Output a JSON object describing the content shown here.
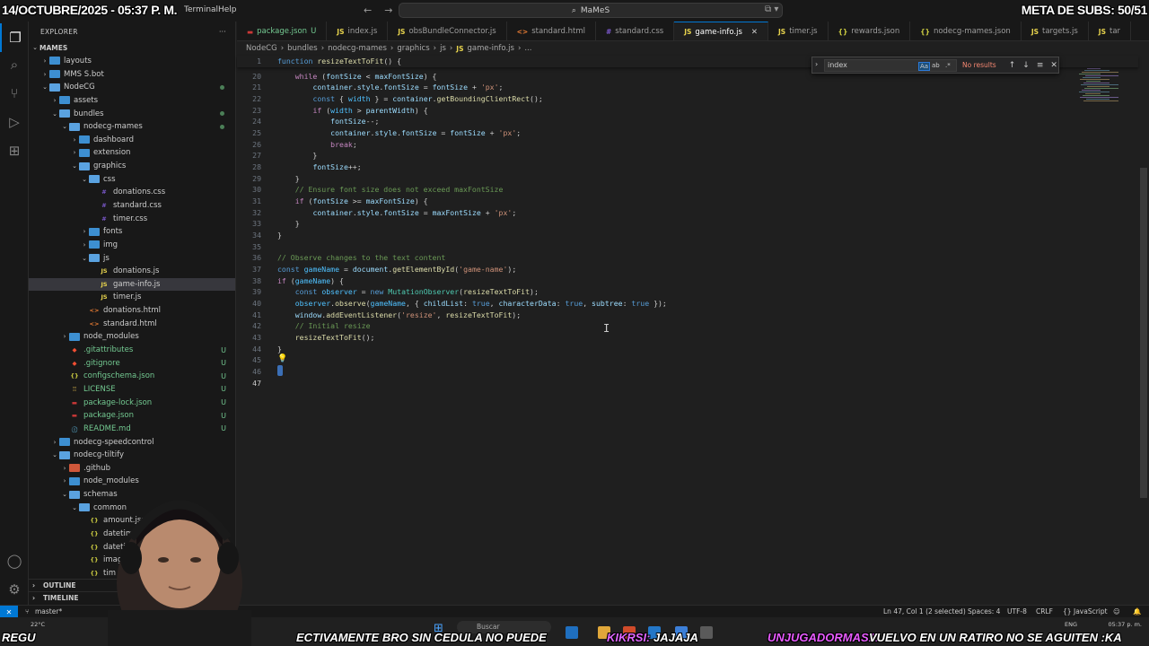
{
  "overlay": {
    "date": "14/OCTUBRE/2025 - 05:37 P. M.",
    "subs": "META DE SUBS: 50/51"
  },
  "titlebar": {
    "menus": [
      "Terminal",
      "Help"
    ],
    "command_center": "MaMeS"
  },
  "sidebar": {
    "title": "EXPLORER",
    "root": "MAMES",
    "tree": [
      {
        "label": "layouts",
        "kind": "folder",
        "indent": 1,
        "open": false
      },
      {
        "label": "MMS S.bot",
        "kind": "folder",
        "indent": 1,
        "open": false
      },
      {
        "label": "NodeCG",
        "kind": "folder",
        "indent": 1,
        "open": true,
        "mod": true
      },
      {
        "label": "assets",
        "kind": "folder",
        "indent": 2,
        "open": false
      },
      {
        "label": "bundles",
        "kind": "folder",
        "indent": 2,
        "open": true,
        "mod": true
      },
      {
        "label": "nodecg-mames",
        "kind": "folder",
        "indent": 3,
        "open": true,
        "mod": true
      },
      {
        "label": "dashboard",
        "kind": "folder",
        "indent": 4,
        "open": false
      },
      {
        "label": "extension",
        "kind": "folder",
        "indent": 4,
        "open": false
      },
      {
        "label": "graphics",
        "kind": "folder",
        "indent": 4,
        "open": true
      },
      {
        "label": "css",
        "kind": "folder",
        "indent": 5,
        "open": true
      },
      {
        "label": "donations.css",
        "kind": "css",
        "indent": 6
      },
      {
        "label": "standard.css",
        "kind": "css",
        "indent": 6
      },
      {
        "label": "timer.css",
        "kind": "css",
        "indent": 6
      },
      {
        "label": "fonts",
        "kind": "folder",
        "indent": 5,
        "open": false
      },
      {
        "label": "img",
        "kind": "folder",
        "indent": 5,
        "open": false
      },
      {
        "label": "js",
        "kind": "folder",
        "indent": 5,
        "open": true
      },
      {
        "label": "donations.js",
        "kind": "js",
        "indent": 6
      },
      {
        "label": "game-info.js",
        "kind": "js",
        "indent": 6,
        "selected": true
      },
      {
        "label": "timer.js",
        "kind": "js",
        "indent": 6
      },
      {
        "label": "donations.html",
        "kind": "html",
        "indent": 5
      },
      {
        "label": "standard.html",
        "kind": "html",
        "indent": 5
      },
      {
        "label": "node_modules",
        "kind": "folder",
        "indent": 3,
        "open": false
      },
      {
        "label": ".gitattributes",
        "kind": "git",
        "indent": 3,
        "badge": "U"
      },
      {
        "label": ".gitignore",
        "kind": "git",
        "indent": 3,
        "badge": "U"
      },
      {
        "label": "configschema.json",
        "kind": "json",
        "indent": 3,
        "badge": "U"
      },
      {
        "label": "LICENSE",
        "kind": "license",
        "indent": 3,
        "badge": "U"
      },
      {
        "label": "package-lock.json",
        "kind": "npm",
        "indent": 3,
        "badge": "U"
      },
      {
        "label": "package.json",
        "kind": "npm",
        "indent": 3,
        "badge": "U"
      },
      {
        "label": "README.md",
        "kind": "md",
        "indent": 3,
        "badge": "U"
      },
      {
        "label": "nodecg-speedcontrol",
        "kind": "folder",
        "indent": 2,
        "open": false
      },
      {
        "label": "nodecg-tiltify",
        "kind": "folder",
        "indent": 2,
        "open": true
      },
      {
        "label": ".github",
        "kind": "gitfolder",
        "indent": 3,
        "open": false
      },
      {
        "label": "node_modules",
        "kind": "folder",
        "indent": 3,
        "open": false
      },
      {
        "label": "schemas",
        "kind": "folder",
        "indent": 3,
        "open": true
      },
      {
        "label": "common",
        "kind": "folder",
        "indent": 4,
        "open": true
      },
      {
        "label": "amount.json",
        "kind": "json",
        "indent": 5
      },
      {
        "label": "datetime-n",
        "kind": "json",
        "indent": 5
      },
      {
        "label": "datetime.js",
        "kind": "json",
        "indent": 5
      },
      {
        "label": "imag",
        "kind": "json",
        "indent": 5
      },
      {
        "label": "tim",
        "kind": "json",
        "indent": 5
      }
    ],
    "sections": [
      "OUTLINE",
      "TIMELINE"
    ]
  },
  "tabs": [
    {
      "label": "package.json",
      "icon": "npm",
      "suffix": "U"
    },
    {
      "label": "index.js",
      "icon": "js"
    },
    {
      "label": "obsBundleConnector.js",
      "icon": "js"
    },
    {
      "label": "standard.html",
      "icon": "html"
    },
    {
      "label": "standard.css",
      "icon": "css"
    },
    {
      "label": "game-info.js",
      "icon": "js",
      "active": true
    },
    {
      "label": "timer.js",
      "icon": "js"
    },
    {
      "label": "rewards.json",
      "icon": "json"
    },
    {
      "label": "nodecg-mames.json",
      "icon": "json"
    },
    {
      "label": "targets.js",
      "icon": "js"
    },
    {
      "label": "tar",
      "icon": "js"
    }
  ],
  "breadcrumb": [
    "NodeCG",
    "bundles",
    "nodecg-mames",
    "graphics",
    "js",
    "game-info.js",
    "..."
  ],
  "find": {
    "query": "index",
    "result": "No results",
    "options": [
      "Aa",
      "ab",
      ".*"
    ]
  },
  "editor": {
    "sticky": {
      "ln": "1",
      "code": [
        [
          "kw",
          "function "
        ],
        [
          "fn",
          "resizeTextToFit"
        ],
        [
          "p",
          "() {"
        ]
      ]
    },
    "lines": [
      {
        "ln": "20",
        "code": [
          [
            "p",
            "    "
          ],
          [
            "ctl",
            "while"
          ],
          [
            "p",
            " ("
          ],
          [
            "var",
            "fontSize"
          ],
          [
            "p",
            " < "
          ],
          [
            "var",
            "maxFontSize"
          ],
          [
            "p",
            ") {"
          ]
        ]
      },
      {
        "ln": "21",
        "code": [
          [
            "p",
            "        "
          ],
          [
            "var",
            "container"
          ],
          [
            "p",
            "."
          ],
          [
            "var",
            "style"
          ],
          [
            "p",
            "."
          ],
          [
            "var",
            "fontSize"
          ],
          [
            "p",
            " = "
          ],
          [
            "var",
            "fontSize"
          ],
          [
            "p",
            " + "
          ],
          [
            "str",
            "'px'"
          ],
          [
            "p",
            ";"
          ]
        ]
      },
      {
        "ln": "22",
        "code": [
          [
            "p",
            "        "
          ],
          [
            "kw",
            "const"
          ],
          [
            "p",
            " { "
          ],
          [
            "const",
            "width"
          ],
          [
            "p",
            " } = "
          ],
          [
            "var",
            "container"
          ],
          [
            "p",
            "."
          ],
          [
            "fn",
            "getBoundingClientRect"
          ],
          [
            "p",
            "();"
          ]
        ]
      },
      {
        "ln": "23",
        "code": [
          [
            "p",
            "        "
          ],
          [
            "ctl",
            "if"
          ],
          [
            "p",
            " ("
          ],
          [
            "const",
            "width"
          ],
          [
            "p",
            " > "
          ],
          [
            "var",
            "parentWidth"
          ],
          [
            "p",
            ") {"
          ]
        ]
      },
      {
        "ln": "24",
        "code": [
          [
            "p",
            "            "
          ],
          [
            "var",
            "fontSize"
          ],
          [
            "p",
            "--;"
          ]
        ]
      },
      {
        "ln": "25",
        "code": [
          [
            "p",
            "            "
          ],
          [
            "var",
            "container"
          ],
          [
            "p",
            "."
          ],
          [
            "var",
            "style"
          ],
          [
            "p",
            "."
          ],
          [
            "var",
            "fontSize"
          ],
          [
            "p",
            " = "
          ],
          [
            "var",
            "fontSize"
          ],
          [
            "p",
            " + "
          ],
          [
            "str",
            "'px'"
          ],
          [
            "p",
            ";"
          ]
        ]
      },
      {
        "ln": "26",
        "code": [
          [
            "p",
            "            "
          ],
          [
            "ctl",
            "break"
          ],
          [
            "p",
            ";"
          ]
        ]
      },
      {
        "ln": "27",
        "code": [
          [
            "p",
            "        }"
          ]
        ]
      },
      {
        "ln": "28",
        "code": [
          [
            "p",
            "        "
          ],
          [
            "var",
            "fontSize"
          ],
          [
            "p",
            "++;"
          ]
        ]
      },
      {
        "ln": "29",
        "code": [
          [
            "p",
            "    }"
          ]
        ]
      },
      {
        "ln": "30",
        "code": [
          [
            "p",
            "    "
          ],
          [
            "cmt",
            "// Ensure font size does not exceed maxFontSize"
          ]
        ]
      },
      {
        "ln": "31",
        "code": [
          [
            "p",
            "    "
          ],
          [
            "ctl",
            "if"
          ],
          [
            "p",
            " ("
          ],
          [
            "var",
            "fontSize"
          ],
          [
            "p",
            " >= "
          ],
          [
            "var",
            "maxFontSize"
          ],
          [
            "p",
            ") {"
          ]
        ]
      },
      {
        "ln": "32",
        "code": [
          [
            "p",
            "        "
          ],
          [
            "var",
            "container"
          ],
          [
            "p",
            "."
          ],
          [
            "var",
            "style"
          ],
          [
            "p",
            "."
          ],
          [
            "var",
            "fontSize"
          ],
          [
            "p",
            " = "
          ],
          [
            "var",
            "maxFontSize"
          ],
          [
            "p",
            " + "
          ],
          [
            "str",
            "'px'"
          ],
          [
            "p",
            ";"
          ]
        ]
      },
      {
        "ln": "33",
        "code": [
          [
            "p",
            "    }"
          ]
        ]
      },
      {
        "ln": "34",
        "code": [
          [
            "p",
            "}"
          ]
        ]
      },
      {
        "ln": "35",
        "code": []
      },
      {
        "ln": "36",
        "code": [
          [
            "cmt",
            "// Observe changes to the text content"
          ]
        ]
      },
      {
        "ln": "37",
        "code": [
          [
            "kw",
            "const"
          ],
          [
            "p",
            " "
          ],
          [
            "const",
            "gameName"
          ],
          [
            "p",
            " = "
          ],
          [
            "var",
            "document"
          ],
          [
            "p",
            "."
          ],
          [
            "fn",
            "getElementById"
          ],
          [
            "p",
            "("
          ],
          [
            "str",
            "'game-name'"
          ],
          [
            "p",
            ");"
          ]
        ]
      },
      {
        "ln": "38",
        "code": [
          [
            "ctl",
            "if"
          ],
          [
            "p",
            " ("
          ],
          [
            "const",
            "gameName"
          ],
          [
            "p",
            ") {"
          ]
        ]
      },
      {
        "ln": "39",
        "code": [
          [
            "p",
            "    "
          ],
          [
            "kw",
            "const"
          ],
          [
            "p",
            " "
          ],
          [
            "const",
            "observer"
          ],
          [
            "p",
            " = "
          ],
          [
            "kw",
            "new"
          ],
          [
            "p",
            " "
          ],
          [
            "cls",
            "MutationObserver"
          ],
          [
            "p",
            "("
          ],
          [
            "fn",
            "resizeTextToFit"
          ],
          [
            "p",
            ");"
          ]
        ]
      },
      {
        "ln": "40",
        "code": [
          [
            "p",
            "    "
          ],
          [
            "const",
            "observer"
          ],
          [
            "p",
            "."
          ],
          [
            "fn",
            "observe"
          ],
          [
            "p",
            "("
          ],
          [
            "const",
            "gameName"
          ],
          [
            "p",
            ", { "
          ],
          [
            "var",
            "childList"
          ],
          [
            "p",
            ": "
          ],
          [
            "kw",
            "true"
          ],
          [
            "p",
            ", "
          ],
          [
            "var",
            "characterData"
          ],
          [
            "p",
            ": "
          ],
          [
            "kw",
            "true"
          ],
          [
            "p",
            ", "
          ],
          [
            "var",
            "subtree"
          ],
          [
            "p",
            ": "
          ],
          [
            "kw",
            "true"
          ],
          [
            "p",
            " });"
          ]
        ]
      },
      {
        "ln": "41",
        "code": [
          [
            "p",
            "    "
          ],
          [
            "var",
            "window"
          ],
          [
            "p",
            "."
          ],
          [
            "fn",
            "addEventListener"
          ],
          [
            "p",
            "("
          ],
          [
            "str",
            "'resize'"
          ],
          [
            "p",
            ", "
          ],
          [
            "fn",
            "resizeTextToFit"
          ],
          [
            "p",
            ");"
          ]
        ]
      },
      {
        "ln": "42",
        "code": [
          [
            "p",
            "    "
          ],
          [
            "cmt",
            "// Initial resize"
          ]
        ]
      },
      {
        "ln": "43",
        "code": [
          [
            "p",
            "    "
          ],
          [
            "fn",
            "resizeTextToFit"
          ],
          [
            "p",
            "();"
          ]
        ]
      },
      {
        "ln": "44",
        "code": [
          [
            "p",
            "}"
          ]
        ]
      },
      {
        "ln": "45",
        "code": []
      },
      {
        "ln": "46",
        "code": []
      },
      {
        "ln": "47",
        "code": [],
        "current": true
      }
    ]
  },
  "statusbar": {
    "branch": "master*",
    "position": "Ln 47, Col 1 (2 selected)",
    "spaces": "Spaces: 4",
    "encoding": "UTF-8",
    "eol": "CRLF",
    "language": "JavaScript"
  },
  "taskbar": {
    "weather": "22°C",
    "search": "Buscar",
    "time": "05:37 p. m.",
    "lang": "ENG"
  },
  "ticker": {
    "left": "REGU",
    "text1": "ECTIVAMENTE BRO SIN CEDULA NO PUEDE",
    "user1": "KIKRSI:",
    "text2": " JAJAJA",
    "user2": "UNJUGADORMAS1:",
    "text3": " VUELVO EN UN RATIRO NO SE AGUITEN :KA"
  },
  "colors": {
    "accent": "#0078d4",
    "editor_bg": "#1f1f1f",
    "sidebar_bg": "#181818",
    "untracked": "#73c991"
  }
}
